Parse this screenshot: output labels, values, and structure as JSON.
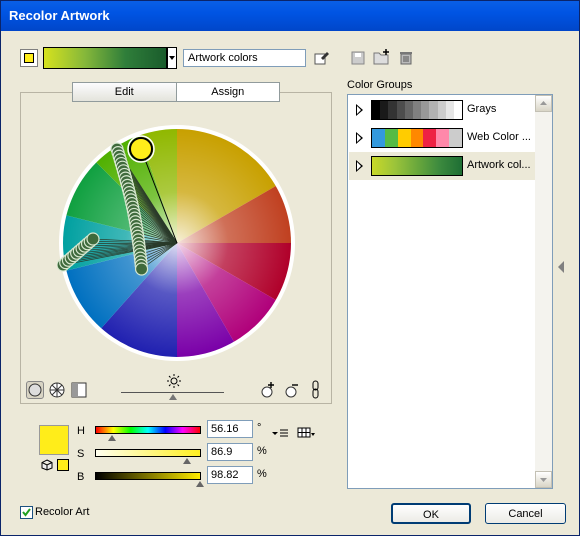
{
  "window": {
    "title": "Recolor Artwork"
  },
  "top": {
    "group_name_value": "Artwork colors"
  },
  "tabs": [
    {
      "label": "Edit"
    },
    {
      "label": "Assign"
    }
  ],
  "color_groups": {
    "heading": "Color Groups",
    "items": [
      {
        "label": "Grays",
        "swatches": [
          "#000000",
          "#1a1a1a",
          "#333333",
          "#4d4d4d",
          "#666666",
          "#808080",
          "#999999",
          "#b3b3b3",
          "#cccccc",
          "#e6e6e6",
          "#ffffff"
        ]
      },
      {
        "label": "Web Color ...",
        "swatches": [
          "#3399dd",
          "#55bb44",
          "#ffcc00",
          "#ff8800",
          "#ee2244",
          "#ff88aa",
          "#cccccc"
        ]
      },
      {
        "label": "Artwork col...",
        "selected": true,
        "swatches": [
          "#c8d828",
          "#9cc43a",
          "#6aa83c",
          "#3c8a3e",
          "#1e6e34"
        ]
      }
    ]
  },
  "hsb": {
    "h": {
      "label": "H",
      "value": "56.16",
      "unit": "°",
      "fraction": 0.156
    },
    "s": {
      "label": "S",
      "value": "86.9",
      "unit": "%",
      "fraction": 0.869
    },
    "b": {
      "label": "B",
      "value": "98.82",
      "unit": "%",
      "fraction": 0.988
    }
  },
  "current_color": "#ffed1a",
  "brightness_fraction": 0.5,
  "footer": {
    "recolor_art_label": "Recolor Art",
    "recolor_art_checked": true,
    "ok_label": "OK",
    "cancel_label": "Cancel"
  },
  "colors": {
    "titlebar": "#0054e3",
    "dialog_bg": "#ece9d8"
  }
}
